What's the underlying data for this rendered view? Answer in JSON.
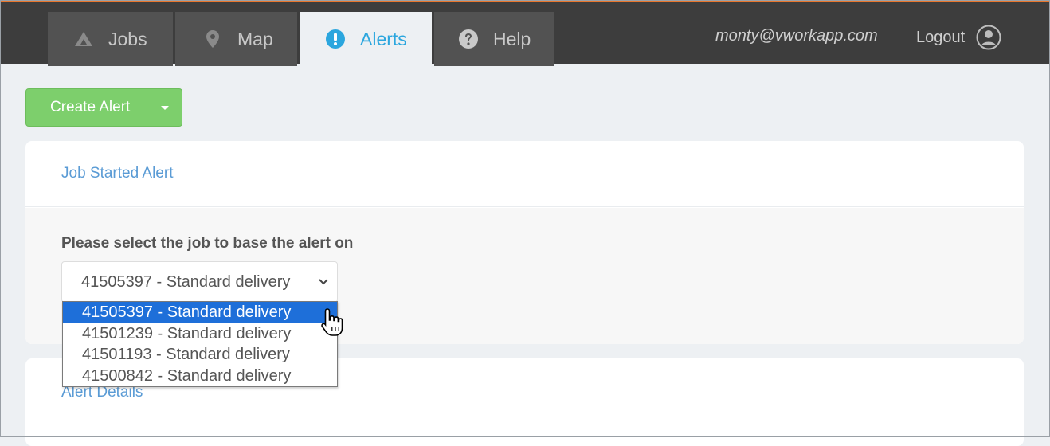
{
  "nav": {
    "tabs": [
      {
        "label": "Jobs",
        "icon": "triangle-icon"
      },
      {
        "label": "Map",
        "icon": "map-pin-icon"
      },
      {
        "label": "Alerts",
        "icon": "exclamation-circle-icon"
      },
      {
        "label": "Help",
        "icon": "question-circle-icon"
      }
    ],
    "active_tab": "Alerts",
    "user_email": "monty@vworkapp.com",
    "logout_label": "Logout"
  },
  "toolbar": {
    "create_alert_label": "Create Alert"
  },
  "job_started_panel": {
    "title": "Job Started Alert",
    "select_label": "Please select the job to base the alert on",
    "selected_job": "41505397 - Standard delivery",
    "options": [
      "41505397 - Standard delivery",
      "41501239 - Standard delivery",
      "41501193 - Standard delivery",
      "41500842 - Standard delivery"
    ]
  },
  "alert_details_panel": {
    "title": "Alert Details"
  },
  "colors": {
    "accent": "#2ba6de",
    "topbar": "#3d3d3d",
    "create_button": "#7dcf6c",
    "link": "#5a9bd5",
    "selection": "#1e6fd9",
    "top_border": "#e8772e"
  }
}
